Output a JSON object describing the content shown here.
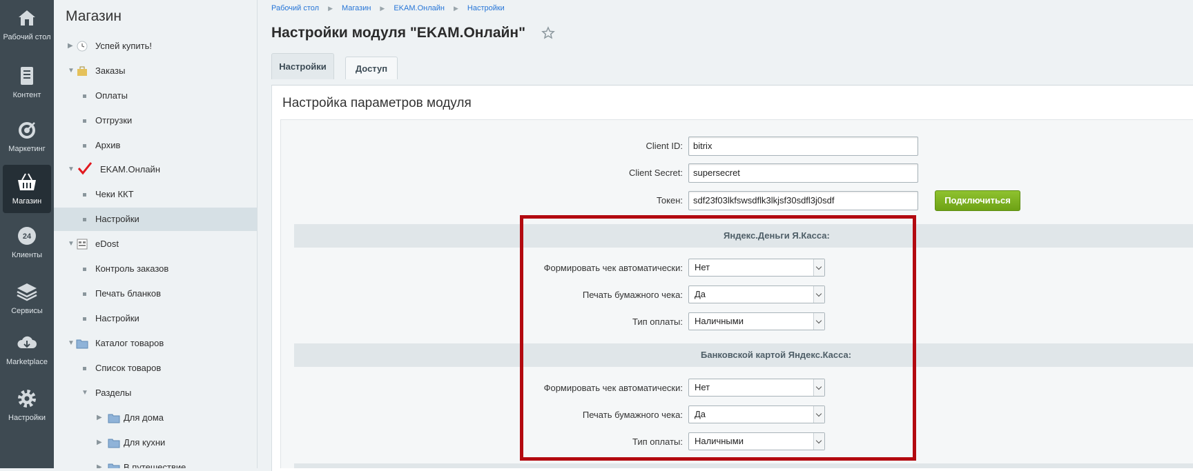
{
  "rail": {
    "items": [
      {
        "label": "Рабочий стол",
        "icon": "home-icon"
      },
      {
        "label": "Контент",
        "icon": "document-icon"
      },
      {
        "label": "Маркетинг",
        "icon": "target-icon"
      },
      {
        "label": "Магазин",
        "icon": "basket-icon"
      },
      {
        "label": "Клиенты",
        "icon": "clients-24-icon"
      },
      {
        "label": "Сервисы",
        "icon": "layers-icon"
      },
      {
        "label": "Marketplace",
        "icon": "cloud-download-icon"
      },
      {
        "label": "Настройки",
        "icon": "gear-icon"
      }
    ],
    "badge_24": "24"
  },
  "tree": {
    "title": "Магазин",
    "items": [
      {
        "label": "Успей купить!"
      },
      {
        "label": "Заказы"
      },
      {
        "label": "Оплаты"
      },
      {
        "label": "Отгрузки"
      },
      {
        "label": "Архив"
      },
      {
        "label": "EKAM.Онлайн"
      },
      {
        "label": "Чеки ККТ"
      },
      {
        "label": "Настройки"
      },
      {
        "label": "eDost"
      },
      {
        "label": "Контроль заказов"
      },
      {
        "label": "Печать бланков"
      },
      {
        "label": "Настройки"
      },
      {
        "label": "Каталог товаров"
      },
      {
        "label": "Список товаров"
      },
      {
        "label": "Разделы"
      },
      {
        "label": "Для дома"
      },
      {
        "label": "Для кухни"
      },
      {
        "label": "В путешествие"
      }
    ]
  },
  "breadcrumbs": [
    "Рабочий стол",
    "Магазин",
    "EKAM.Онлайн",
    "Настройки"
  ],
  "page_title": "Настройки модуля \"EKAM.Онлайн\"",
  "tabs": [
    {
      "label": "Настройки"
    },
    {
      "label": "Доступ"
    }
  ],
  "panel_title": "Настройка параметров модуля",
  "fields": {
    "client_id": {
      "label": "Client ID:",
      "value": "bitrix"
    },
    "client_secret": {
      "label": "Client Secret:",
      "value": "supersecret"
    },
    "token": {
      "label": "Токен:",
      "value": "sdf23f03lkfswsdflk3lkjsf30sdfl3j0sdf"
    },
    "connect_button": "Подключиться"
  },
  "sections": [
    {
      "title": "Яндекс.Деньги  Я.Касса:",
      "rows": [
        {
          "label": "Формировать чек автоматически:",
          "value": "Нет"
        },
        {
          "label": "Печать бумажного чека:",
          "value": "Да"
        },
        {
          "label": "Тип оплаты:",
          "value": "Наличными"
        }
      ]
    },
    {
      "title": "Банковской картой Яндекс.Касса:",
      "rows": [
        {
          "label": "Формировать чек автоматически:",
          "value": "Нет"
        },
        {
          "label": "Печать бумажного чека:",
          "value": "Да"
        },
        {
          "label": "Тип оплаты:",
          "value": "Наличными"
        }
      ]
    }
  ],
  "colors": {
    "highlight_border": "#b30a10",
    "button_green": "#7ab01f",
    "link_blue": "#2675d7"
  }
}
